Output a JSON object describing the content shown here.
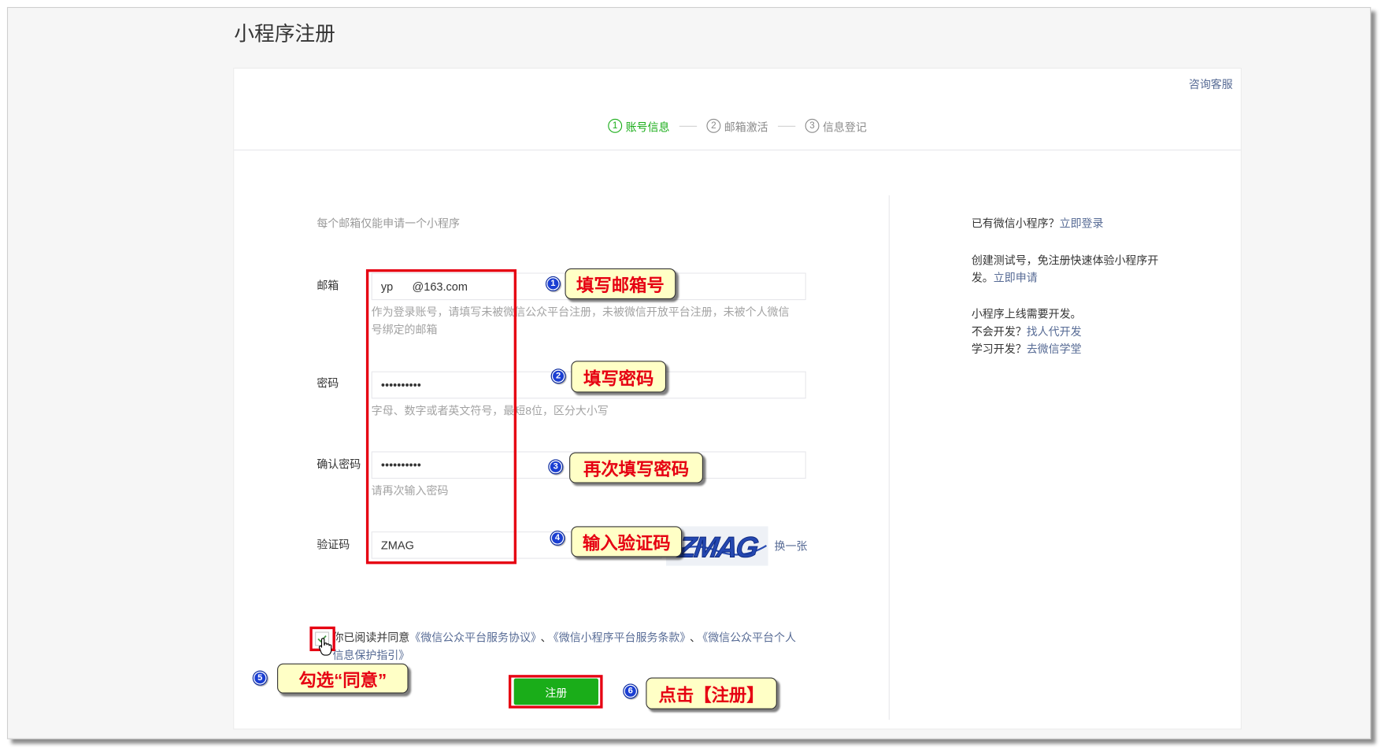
{
  "colors": {
    "accent_green": "#1aad19",
    "link_blue": "#576b95",
    "annotation_red": "#e60012",
    "callout_yellow": "#ffffc6",
    "badge_blue": "#1b3fd3"
  },
  "page": {
    "title": "小程序注册"
  },
  "header": {
    "support_link": "咨询客服"
  },
  "steps": [
    {
      "number": "1",
      "label": "账号信息",
      "active": true
    },
    {
      "number": "2",
      "label": "邮箱激活",
      "active": false
    },
    {
      "number": "3",
      "label": "信息登记",
      "active": false
    }
  ],
  "form": {
    "notice": "每个邮箱仅能申请一个小程序",
    "email": {
      "label": "邮箱",
      "value": "yp      @163.com",
      "hint": "作为登录账号，请填写未被微信公众平台注册，未被微信开放平台注册，未被个人微信号绑定的邮箱"
    },
    "password": {
      "label": "密码",
      "value": "••••••••••",
      "hint": "字母、数字或者英文符号，最短8位，区分大小写"
    },
    "confirm_password": {
      "label": "确认密码",
      "value": "••••••••••",
      "hint": "请再次输入密码"
    },
    "captcha": {
      "label": "验证码",
      "value": "ZMAG",
      "image_text": "ZMAG",
      "refresh_link": "换一张"
    },
    "agreement": {
      "checked": true,
      "prefix": "你已阅读并同意",
      "separator": "、",
      "links": [
        "《微信公众平台服务协议》",
        "《微信小程序平台服务条款》",
        "《微信公众平台个人信息保护指引》"
      ]
    },
    "submit_label": "注册"
  },
  "sidebar": {
    "login": {
      "text": "已有微信小程序？",
      "link": "立即登录"
    },
    "test_account": {
      "text": "创建测试号，免注册快速体验小程序开发。",
      "link": "立即申请"
    },
    "dev_notice": "小程序上线需要开发。",
    "outsource": {
      "text": "不会开发？",
      "link": "找人代开发"
    },
    "learn": {
      "text": "学习开发？",
      "link": "去微信学堂"
    }
  },
  "annotations": [
    {
      "number": "1",
      "text": "填写邮箱号"
    },
    {
      "number": "2",
      "text": "填写密码"
    },
    {
      "number": "3",
      "text": "再次填写密码"
    },
    {
      "number": "4",
      "text": "输入验证码"
    },
    {
      "number": "5",
      "text": "勾选“同意”"
    },
    {
      "number": "6",
      "text": "点击【注册】"
    }
  ]
}
